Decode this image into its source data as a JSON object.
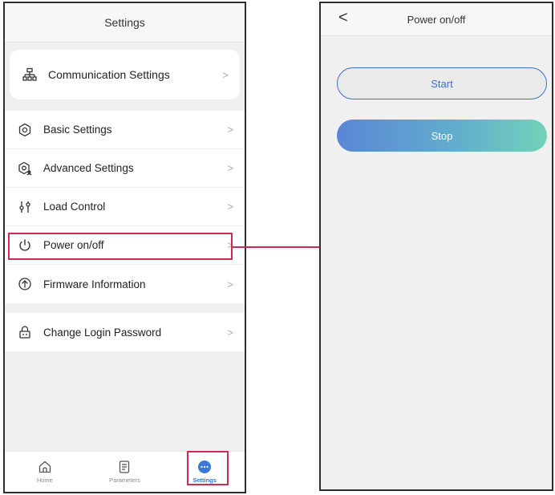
{
  "left_screen": {
    "header_title": "Settings",
    "communication": {
      "label": "Communication Settings",
      "icon": "network-icon"
    },
    "menu_items": [
      {
        "label": "Basic Settings",
        "icon": "gear-icon"
      },
      {
        "label": "Advanced Settings",
        "icon": "gear-user-icon"
      },
      {
        "label": "Load Control",
        "icon": "sliders-icon"
      },
      {
        "label": "Power on/off",
        "icon": "power-icon"
      },
      {
        "label": "Firmware Information",
        "icon": "upload-icon"
      }
    ],
    "password_item": {
      "label": "Change Login Password",
      "icon": "lock-icon"
    },
    "tabs": [
      {
        "label": "Home",
        "icon": "home-icon"
      },
      {
        "label": "Parameters",
        "icon": "document-icon"
      },
      {
        "label": "Settings",
        "icon": "more-icon",
        "active": true
      }
    ],
    "chevron": ">"
  },
  "right_screen": {
    "header_title": "Power on/off",
    "back_glyph": "<",
    "start_label": "Start",
    "stop_label": "Stop"
  },
  "colors": {
    "highlight": "#d22a4f",
    "accent_blue": "#3f6fc5",
    "stop_gradient_start": "#5a86d6",
    "stop_gradient_end": "#72d3b8"
  }
}
